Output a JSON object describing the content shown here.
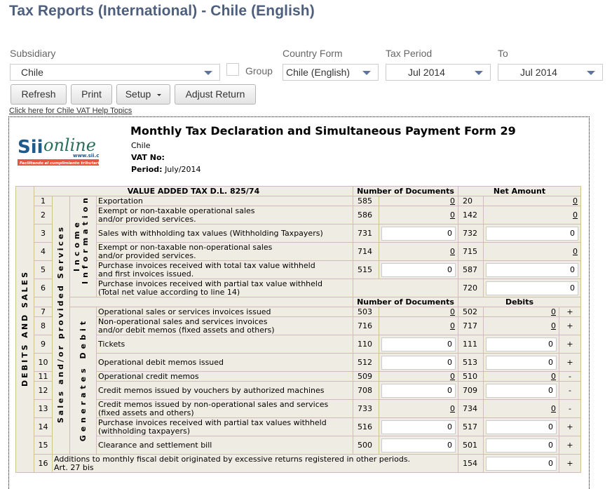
{
  "page": {
    "title": "Tax Reports (International) - Chile (English)"
  },
  "filters": {
    "subsidiary": {
      "label": "Subsidiary",
      "value": "Chile"
    },
    "group": {
      "label": "Group",
      "checked": false
    },
    "country_form": {
      "label": "Country Form",
      "value": "Chile (English)"
    },
    "tax_period": {
      "label": "Tax Period",
      "value": "Jul 2014"
    },
    "to": {
      "label": "To",
      "value": "Jul 2014"
    }
  },
  "toolbar": {
    "refresh_label": "Refresh",
    "print_label": "Print",
    "setup_label": "Setup",
    "adjust_label": "Adjust Return"
  },
  "help_link": "Click here for Chile VAT Help Topics",
  "form": {
    "logo_text": "SII online",
    "logo_url_text": "www.sii.cl",
    "logo_tagline": "Facilitando el cumplimiento tributario",
    "title": "Monthly Tax Declaration and Simultaneous Payment Form 29",
    "company": "Chile",
    "vat_label": "VAT No:",
    "vat_value": "",
    "period_label": "Period:",
    "period_value": "July/2014",
    "colors": {
      "grid_bg": "#efede3",
      "grid_border": "#d3c48e"
    }
  },
  "table": {
    "section_header": "VALUE ADDED TAX D.L. 825/74",
    "col_docs": "Number of Documents",
    "col_net": "Net Amount",
    "col_debits": "Debits",
    "side_outer": "DEBITS AND SALES",
    "side_mid": "Sales and/or provided Services",
    "side_income": "Income Information",
    "side_debit": "Generates Debit",
    "income_rows": [
      {
        "n": "1",
        "desc": "Exportation",
        "c1": "585",
        "v1": "0",
        "v1_input": false,
        "c2": "20",
        "v2": "0",
        "v2_input": false
      },
      {
        "n": "2",
        "desc": "Exempt or non-taxable operational sales\nand/or provided services.",
        "c1": "586",
        "v1": "0",
        "v1_input": false,
        "c2": "142",
        "v2": "0",
        "v2_input": false
      },
      {
        "n": "3",
        "desc": "Sales with withholding tax values (Withholding Taxpayers)",
        "c1": "731",
        "v1": "0",
        "v1_input": true,
        "c2": "732",
        "v2": "0",
        "v2_input": true
      },
      {
        "n": "4",
        "desc": "Exempt or non-taxable non-operational sales\nand/or provided services.",
        "c1": "714",
        "v1": "0",
        "v1_input": false,
        "c2": "715",
        "v2": "0",
        "v2_input": false
      },
      {
        "n": "5",
        "desc": "Purchase invoices received with total tax value withheld\nand first invoices issued.",
        "c1": "515",
        "v1": "0",
        "v1_input": true,
        "c2": "587",
        "v2": "0",
        "v2_input": true
      },
      {
        "n": "6",
        "desc": "Purchase invoices received with partial tax value withheld\n(Total net value according to line 14)",
        "c1": "",
        "v1": "",
        "v1_input": false,
        "c2": "720",
        "v2": "0",
        "v2_input": true
      }
    ],
    "debit_rows": [
      {
        "n": "7",
        "desc": "Operational sales or services invoices issued",
        "c1": "503",
        "v1": "0",
        "v1_input": false,
        "c2": "502",
        "v2": "0",
        "v2_input": false,
        "sign": "+"
      },
      {
        "n": "8",
        "desc": "Non-operational sales and services invoices\nand/or debit memos (fixed assets and others)",
        "c1": "716",
        "v1": "0",
        "v1_input": false,
        "c2": "717",
        "v2": "0",
        "v2_input": false,
        "sign": "+"
      },
      {
        "n": "9",
        "desc": "Tickets",
        "c1": "110",
        "v1": "0",
        "v1_input": true,
        "c2": "111",
        "v2": "0",
        "v2_input": true,
        "sign": "+"
      },
      {
        "n": "10",
        "desc": "Operational debit memos issued",
        "c1": "512",
        "v1": "0",
        "v1_input": true,
        "c2": "513",
        "v2": "0",
        "v2_input": true,
        "sign": "+"
      },
      {
        "n": "11",
        "desc": "Operational credit memos",
        "c1": "509",
        "v1": "0",
        "v1_input": false,
        "c2": "510",
        "v2": "0",
        "v2_input": false,
        "sign": "-"
      },
      {
        "n": "12",
        "desc": "Credit memos issued by vouchers by authorized machines",
        "c1": "708",
        "v1": "0",
        "v1_input": true,
        "c2": "709",
        "v2": "0",
        "v2_input": true,
        "sign": "-"
      },
      {
        "n": "13",
        "desc": "Credit memos issued by non-operational sales and services\n(fixed assets and others)",
        "c1": "733",
        "v1": "0",
        "v1_input": false,
        "c2": "734",
        "v2": "0",
        "v2_input": false,
        "sign": "-"
      },
      {
        "n": "14",
        "desc": "Purchase invoices received with partial tax values withheld\n(withholding taxpayers)",
        "c1": "516",
        "v1": "0",
        "v1_input": true,
        "c2": "517",
        "v2": "0",
        "v2_input": true,
        "sign": "+"
      },
      {
        "n": "15",
        "desc": "Clearance and settlement bill",
        "c1": "500",
        "v1": "0",
        "v1_input": true,
        "c2": "501",
        "v2": "0",
        "v2_input": true,
        "sign": "+"
      }
    ],
    "row16": {
      "n": "16",
      "desc": "Additions to monthly fiscal debit originated by excessive returns registered in other periods.\nArt. 27 bis",
      "c2": "154",
      "v2": "0",
      "v2_input": true,
      "sign": "+"
    }
  }
}
